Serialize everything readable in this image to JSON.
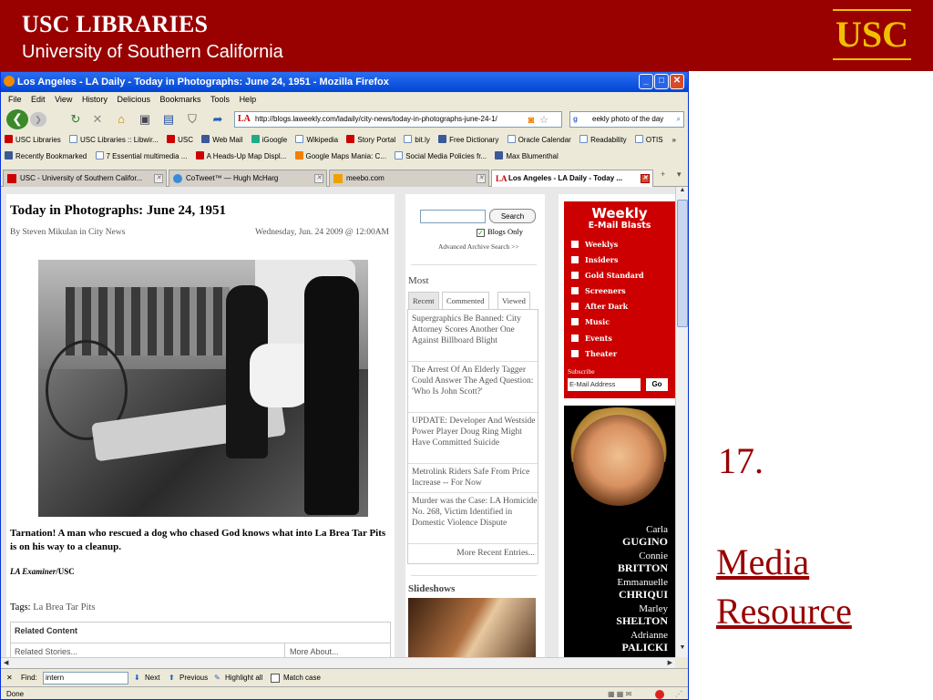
{
  "slide": {
    "header_line1": "USC LIBRARIES",
    "header_line2": "University of Southern California",
    "logo": "USC",
    "caption_number": "17.",
    "caption_link_line1": "Media",
    "caption_link_line2": "Resource",
    "colors": {
      "brand": "#990000",
      "gold": "#f0c000"
    }
  },
  "window": {
    "title": "Los Angeles - LA Daily - Today in Photographs: June 24, 1951 - Mozilla Firefox"
  },
  "menu": [
    "File",
    "Edit",
    "View",
    "History",
    "Delicious",
    "Bookmarks",
    "Tools",
    "Help"
  ],
  "nav": {
    "url": "http://blogs.laweekly.com/ladaily/city-news/today-in-photographs-june-24-1/",
    "url_site_icon": "LA",
    "search_value": "eekly photo of the day"
  },
  "bookmarks1": [
    "USC Libraries",
    "USC Libraries :: Libwir...",
    "USC",
    "Web Mail",
    "iGoogle",
    "Wikipedia",
    "Story Portal",
    "bit.ly",
    "Free Dictionary",
    "Oracle Calendar",
    "Readability",
    "OTIS"
  ],
  "bookmarks2": [
    "Recently Bookmarked",
    "7 Essential multimedia ...",
    "A Heads-Up Map Displ...",
    "Google Maps Mania: C...",
    "Social Media Policies fr...",
    "Max Blumenthal"
  ],
  "tabs": [
    "USC - University of Southern Califor...",
    "CoTweet™ — Hugh McHarg",
    "meebo.com",
    "Los Angeles - LA Daily - Today ..."
  ],
  "article": {
    "title": "Today in Photographs: June 24, 1951",
    "byline": "By Steven Mikulan in City News",
    "date": "Wednesday, Jun. 24 2009 @ 12:00AM",
    "caption": "Tarnation! A man who rescued a dog who chased God knows what into La Brea Tar Pits is on his way to a cleanup.",
    "credit_italic": "LA Examiner",
    "credit_rest": "/USC",
    "tags_label": "Tags:",
    "tags_value": "La Brea Tar Pits",
    "related_header": "Related Content",
    "related_stories": "Related Stories...",
    "related_more": "More About..."
  },
  "midcol": {
    "search_button": "Search",
    "blogs_only": "Blogs Only",
    "advanced": "Advanced Archive Search >>",
    "most": "Most",
    "tabs": [
      "Recent",
      "Commented",
      "Viewed"
    ],
    "items": [
      "Supergraphics Be Banned: City Attorney Scores Another One Against Billboard Blight",
      "The Arrest Of An Elderly Tagger Could Answer The Aged Question: 'Who Is John Scott?'",
      "UPDATE: Developer And Westside Power Player Doug Ring Might Have Committed Suicide",
      "Metrolink Riders Safe From Price Increase -- For Now",
      "Murder was the Case: LA Homicide No. 268, Victim Identified in Domestic Violence Dispute"
    ],
    "more": "More Recent Entries...",
    "slideshows": "Slideshows"
  },
  "rightcol": {
    "weekly_title": "Weekly",
    "weekly_sub": "E-Mail Blasts",
    "options": [
      "Weeklys",
      "Insiders",
      "Gold Standard",
      "Screeners",
      "After Dark",
      "Music",
      "Events",
      "Theater"
    ],
    "subscribe": "Subscribe",
    "email_placeholder": "E-Mail Address",
    "go": "Go",
    "ad_names": [
      {
        "first": "Carla",
        "last": "GUGINO"
      },
      {
        "first": "Connie",
        "last": "BRITTON"
      },
      {
        "first": "Emmanuelle",
        "last": "CHRIQUI"
      },
      {
        "first": "Marley",
        "last": "SHELTON"
      },
      {
        "first": "Adrianne",
        "last": "PALICKI"
      }
    ]
  },
  "findbar": {
    "find_label": "Find:",
    "find_value": "intern",
    "next": "Next",
    "previous": "Previous",
    "highlight": "Highlight all",
    "match_case": "Match case"
  },
  "status": "Done"
}
